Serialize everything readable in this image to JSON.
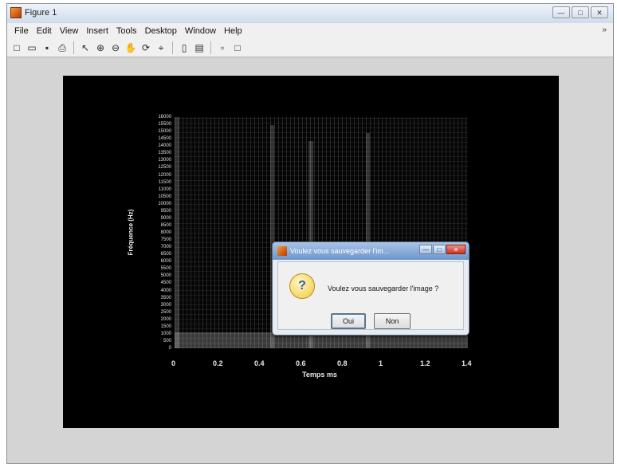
{
  "window": {
    "title": "Figure 1"
  },
  "window_controls": [
    "—",
    "□",
    "✕"
  ],
  "menu": [
    "File",
    "Edit",
    "View",
    "Insert",
    "Tools",
    "Desktop",
    "Window",
    "Help"
  ],
  "menu_arrow": "»",
  "toolbar": [
    {
      "name": "new-figure-icon",
      "glyph": "□"
    },
    {
      "name": "open-file-icon",
      "glyph": "▭"
    },
    {
      "name": "save-icon",
      "glyph": "▪"
    },
    {
      "name": "print-icon",
      "glyph": "⎙"
    },
    {
      "name": "sep"
    },
    {
      "name": "edit-plot-icon",
      "glyph": "↖"
    },
    {
      "name": "zoom-in-icon",
      "glyph": "⊕"
    },
    {
      "name": "zoom-out-icon",
      "glyph": "⊖"
    },
    {
      "name": "pan-icon",
      "glyph": "✋"
    },
    {
      "name": "rotate-3d-icon",
      "glyph": "⟳"
    },
    {
      "name": "data-cursor-icon",
      "glyph": "⌖"
    },
    {
      "name": "sep"
    },
    {
      "name": "colorbar-icon",
      "glyph": "▯"
    },
    {
      "name": "legend-icon",
      "glyph": "▤"
    },
    {
      "name": "sep"
    },
    {
      "name": "hide-plot-tools-icon",
      "glyph": "▫"
    },
    {
      "name": "show-plot-tools-icon",
      "glyph": "□"
    }
  ],
  "plot": {
    "x_ticks": [
      "0",
      "0.2",
      "0.4",
      "0.6",
      "0.8",
      "1",
      "1.2",
      "1.4"
    ],
    "xlabel": "Temps ms",
    "ylabel": "Fréquence (Hz)",
    "y_ticks": [
      "16000",
      "15500",
      "15000",
      "14500",
      "14000",
      "13500",
      "13000",
      "12500",
      "12000",
      "11500",
      "11000",
      "10500",
      "10000",
      "9500",
      "9000",
      "8500",
      "8000",
      "7500",
      "7000",
      "6500",
      "6000",
      "5500",
      "5000",
      "4500",
      "4000",
      "3500",
      "3000",
      "2500",
      "2000",
      "1500",
      "1000",
      "500",
      "0"
    ]
  },
  "dialog": {
    "title": "Voulez vous sauvegarder l'im...",
    "message": "Voulez vous sauvegarder l'image ?",
    "yes_label": "Oui",
    "no_label": "Non",
    "icon_glyph": "?"
  }
}
